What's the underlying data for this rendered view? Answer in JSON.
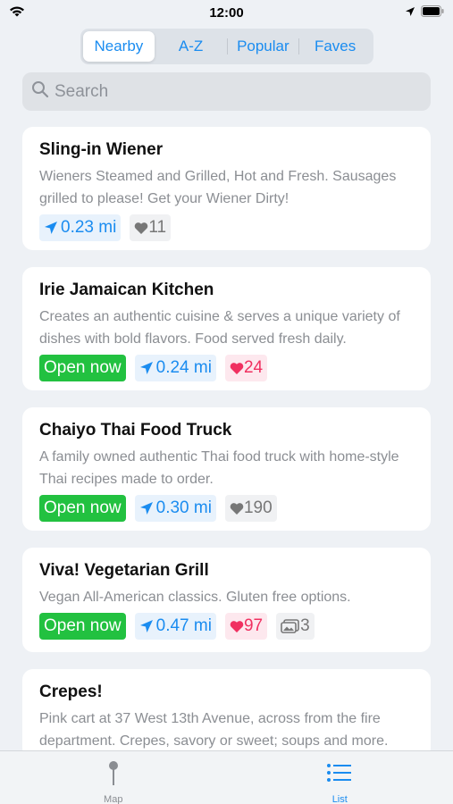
{
  "status_bar": {
    "time": "12:00"
  },
  "segments": [
    {
      "label": "Nearby",
      "active": true
    },
    {
      "label": "A-Z",
      "active": false
    },
    {
      "label": "Popular",
      "active": false
    },
    {
      "label": "Faves",
      "active": false
    }
  ],
  "search": {
    "placeholder": "Search",
    "value": ""
  },
  "listings": [
    {
      "name": "Sling-in Wiener",
      "description": "Wieners Steamed and Grilled, Hot and Fresh. Sausages grilled to please! Get your Wiener Dirty!",
      "open_label": "",
      "distance": "0.23 mi",
      "faves": "11",
      "faved": false,
      "photos": ""
    },
    {
      "name": "Irie Jamaican Kitchen",
      "description": "Creates an authentic cuisine & serves a unique variety of dishes with bold flavors. Food served fresh daily.",
      "open_label": "Open now",
      "distance": "0.24 mi",
      "faves": "24",
      "faved": true,
      "photos": ""
    },
    {
      "name": "Chaiyo Thai Food Truck",
      "description": "A family owned authentic Thai food truck with home-style Thai recipes made to order.",
      "open_label": "Open now",
      "distance": "0.30 mi",
      "faves": "190",
      "faved": false,
      "photos": ""
    },
    {
      "name": "Viva! Vegetarian Grill",
      "description": "Vegan All-American classics. Gluten free options.",
      "open_label": "Open now",
      "distance": "0.47 mi",
      "faves": "97",
      "faved": true,
      "photos": "3"
    },
    {
      "name": "Crepes!",
      "description": "Pink cart at 37 West 13th Avenue, across from the fire department. Crepes, savory or sweet; soups and more.",
      "open_label": "",
      "distance": "",
      "faves": "",
      "faved": false,
      "photos": ""
    }
  ],
  "tab_bar": {
    "tabs": [
      {
        "label": "Map",
        "icon": "map-pin-icon",
        "active": false
      },
      {
        "label": "List",
        "icon": "list-icon",
        "active": true
      }
    ]
  },
  "colors": {
    "accent": "#1a8cf0",
    "open_green": "#22c140",
    "fave_pink": "#f03060",
    "background": "#eef1f5"
  }
}
